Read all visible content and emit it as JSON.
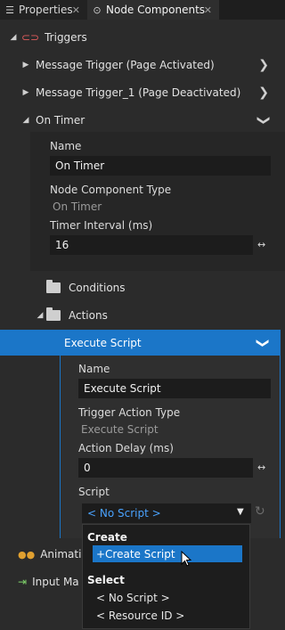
{
  "tabs": [
    {
      "label": "Properties"
    },
    {
      "label": "Node Components"
    }
  ],
  "sections": {
    "triggers": "Triggers",
    "animation": "Animatio",
    "input": "Input Ma"
  },
  "triggers": {
    "items": [
      {
        "label": "Message Trigger (Page Activated)"
      },
      {
        "label": "Message Trigger_1 (Page Deactivated)"
      }
    ],
    "on_timer": {
      "label": "On Timer",
      "name_label": "Name",
      "name_value": "On Timer",
      "type_label": "Node Component Type",
      "type_value": "On Timer",
      "interval_label": "Timer Interval (ms)",
      "interval_value": "16",
      "conditions": "Conditions",
      "actions": "Actions"
    }
  },
  "execute_script": {
    "label": "Execute Script",
    "name_label": "Name",
    "name_value": "Execute Script",
    "type_label": "Trigger Action Type",
    "type_value": "Execute Script",
    "delay_label": "Action Delay (ms)",
    "delay_value": "0",
    "script_label": "Script",
    "script_value": "< No Script >"
  },
  "popup": {
    "create_header": "Create",
    "create_item": "+Create Script",
    "select_header": "Select",
    "select_items": [
      "< No Script >",
      "< Resource ID >"
    ]
  },
  "colors": {
    "accent": "#1b76c8",
    "link": "#4aa3ff"
  }
}
